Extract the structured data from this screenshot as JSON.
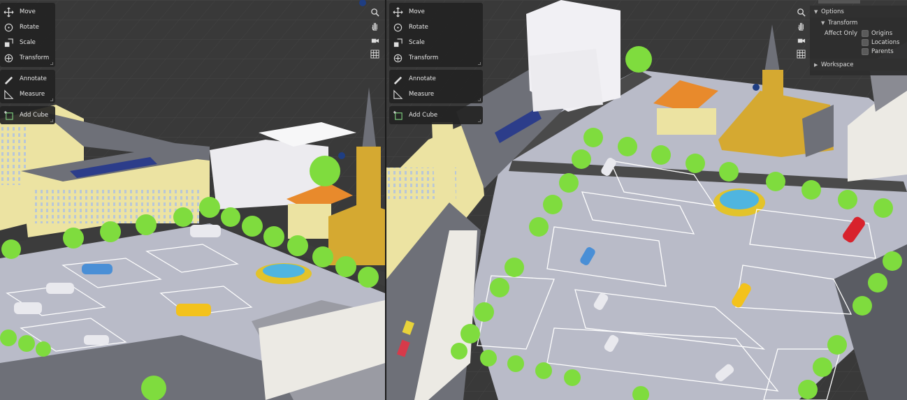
{
  "toolbar": {
    "tools": [
      {
        "label": "Move",
        "icon": "move-icon"
      },
      {
        "label": "Rotate",
        "icon": "rotate-icon"
      },
      {
        "label": "Scale",
        "icon": "scale-icon"
      },
      {
        "label": "Transform",
        "icon": "transform-icon"
      },
      {
        "label": "Annotate",
        "icon": "annotate-icon"
      },
      {
        "label": "Measure",
        "icon": "measure-icon"
      },
      {
        "label": "Add Cube",
        "icon": "add-cube-icon"
      }
    ]
  },
  "nav_buttons": [
    "zoom-icon",
    "pan-hand-icon",
    "camera-icon",
    "grid-icon"
  ],
  "options_panel": {
    "options_label": "Options",
    "transform_label": "Transform",
    "affect_only_label": "Affect Only",
    "checkboxes": [
      {
        "label": "Origins",
        "checked": false
      },
      {
        "label": "Locations",
        "checked": false
      },
      {
        "label": "Parents",
        "checked": false
      }
    ],
    "workspace_label": "Workspace"
  },
  "colors": {
    "viewport_bg": "#3a3a3a",
    "ground": "#b9bbc8",
    "roof_gray": "#6e7078",
    "building_yellow": "#ece3a2",
    "church_gold": "#d5a931",
    "tree_green": "#7fdc3e",
    "orange_roof": "#e88a2c",
    "accent_blue": "#4a8fd6"
  }
}
